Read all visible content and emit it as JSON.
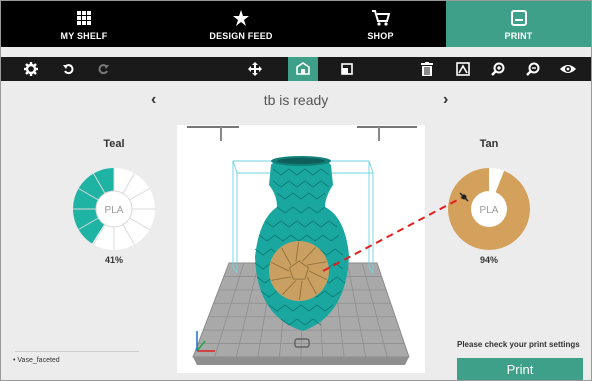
{
  "nav": {
    "tabs": [
      {
        "label": "MY SHELF",
        "icon": "grid-icon"
      },
      {
        "label": "DESIGN FEED",
        "icon": "star-icon"
      },
      {
        "label": "SHOP",
        "icon": "cart-icon"
      },
      {
        "label": "PRINT",
        "icon": "printer-icon",
        "active": true
      }
    ]
  },
  "toolbar": {
    "left": [
      "gear-icon",
      "undo-icon",
      "redo-icon"
    ],
    "center": [
      "move-icon",
      "place-icon",
      "scale-icon"
    ],
    "right": [
      "trash-icon",
      "view-icon",
      "zoom-in-icon",
      "zoom-out-icon",
      "eye-icon"
    ]
  },
  "status": {
    "text": "tb is ready",
    "prev_arrow": "‹",
    "next_arrow": "›"
  },
  "spools": {
    "left": {
      "name": "Teal",
      "material": "PLA",
      "percent": "41%",
      "fill": 0.41,
      "color": "#1fb3a3"
    },
    "right": {
      "name": "Tan",
      "material": "PLA",
      "percent": "94%",
      "fill": 0.94,
      "color": "#d4a15c"
    }
  },
  "file": {
    "name": "Vase_faceted"
  },
  "print": {
    "notice": "Please check your print settings",
    "button_label": "Print"
  },
  "colors": {
    "accent": "#3fa08a",
    "nav_bg": "#000000",
    "toolbar_bg": "#1a1a1a",
    "model_teal": "#1aa7a0",
    "model_tan": "#c9a062",
    "dash_red": "#e02020"
  }
}
